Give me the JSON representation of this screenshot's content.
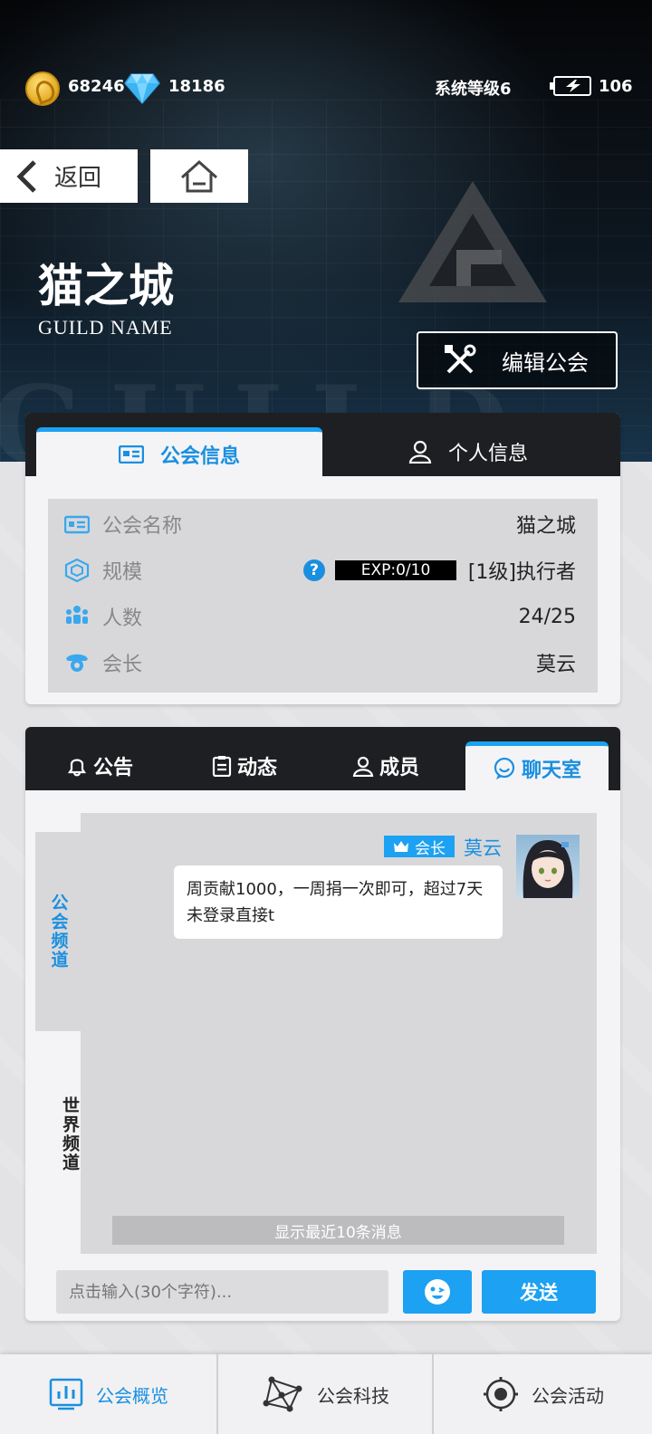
{
  "currency": {
    "coins": "68246",
    "gems": "18186"
  },
  "status": {
    "system_level": "系统等级6",
    "energy": "106"
  },
  "nav": {
    "back_label": "返回"
  },
  "guild": {
    "title": "猫之城",
    "subtitle": "GUILD NAME",
    "edit_label": "编辑公会"
  },
  "info_tabs": [
    "公会信息",
    "个人信息"
  ],
  "info": {
    "name_key": "公会名称",
    "name_value": "猫之城",
    "scale_key": "规模",
    "exp_text": "EXP:0/10",
    "scale_value": "[1级]执行者",
    "members_key": "人数",
    "members_value": "24/25",
    "leader_key": "会长",
    "leader_value": "莫云"
  },
  "chat_tabs": [
    "公告",
    "动态",
    "成员",
    "聊天室"
  ],
  "channels": {
    "guild": "公会频道",
    "world": "世界频道"
  },
  "message": {
    "badge": "会长",
    "sender": "莫云",
    "text": "周贡献1000，一周捐一次即可，超过7天未登录直接t"
  },
  "chat": {
    "show_recent": "显示最近10条消息",
    "input_placeholder": "点击输入(30个字符)...",
    "send_label": "发送"
  },
  "bottom_nav": [
    "公会概览",
    "公会科技",
    "公会活动"
  ],
  "colors": {
    "accent": "#1da1f2",
    "dark": "#1d1f22",
    "panel": "#d8d8da"
  }
}
